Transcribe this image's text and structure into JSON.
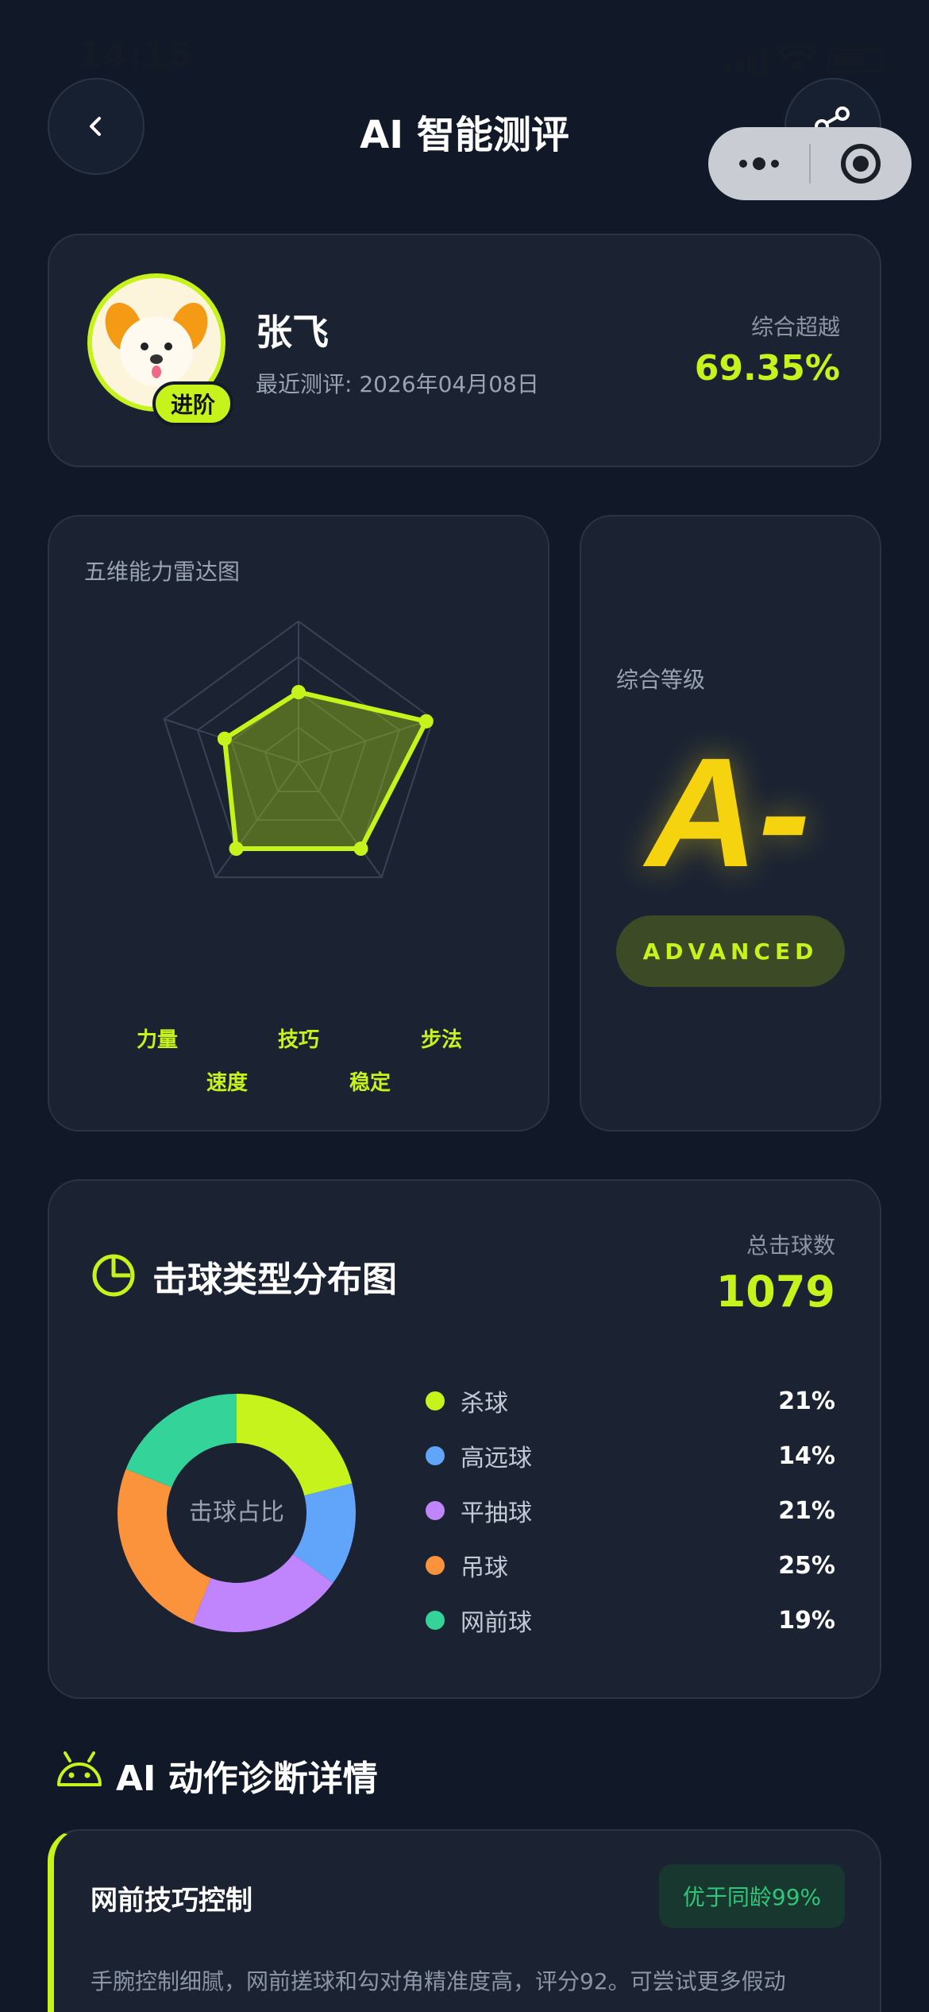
{
  "status_bar": {
    "time": "14:15"
  },
  "header": {
    "title": "AI 智能测评"
  },
  "profile": {
    "name": "张飞",
    "last_test_label": "最近测评: 2026年04月08日",
    "level_badge": "进阶",
    "beat_label": "综合超越",
    "beat_value": "69.35%"
  },
  "radar": {
    "title": "五维能力雷达图",
    "axes": [
      "技巧",
      "步法",
      "稳定",
      "速度",
      "力量"
    ],
    "values": [
      0.5,
      0.95,
      0.75,
      0.75,
      0.55
    ],
    "color": "#c6f31b"
  },
  "grade": {
    "label": "综合等级",
    "letter": "A-",
    "tier": "ADVANCED"
  },
  "distribution": {
    "title": "击球类型分布图",
    "total_label": "总击球数",
    "total_value": "1079",
    "center_label": "击球占比"
  },
  "chart_data": {
    "type": "pie",
    "categories": [
      "杀球",
      "高远球",
      "平抽球",
      "吊球",
      "网前球"
    ],
    "values": [
      21,
      14,
      21,
      25,
      19
    ],
    "labels": [
      "21%",
      "14%",
      "21%",
      "25%",
      "19%"
    ],
    "colors": [
      "#c6f31b",
      "#60a5fa",
      "#c084fc",
      "#fb923c",
      "#34d399"
    ]
  },
  "diagnosis": {
    "section_title": "AI 动作诊断详情",
    "items": [
      {
        "title": "网前技巧控制",
        "badge": "优于同龄99%",
        "desc": "手腕控制细腻，网前搓球和勾对角精准度高，评分92。可尝试更多假动"
      }
    ]
  },
  "icons": {
    "back": "chevron-left-icon",
    "share": "share-icon",
    "more": "more-dots-icon",
    "close": "target-close-icon",
    "pie": "pie-chart-icon",
    "robot": "robot-icon"
  }
}
